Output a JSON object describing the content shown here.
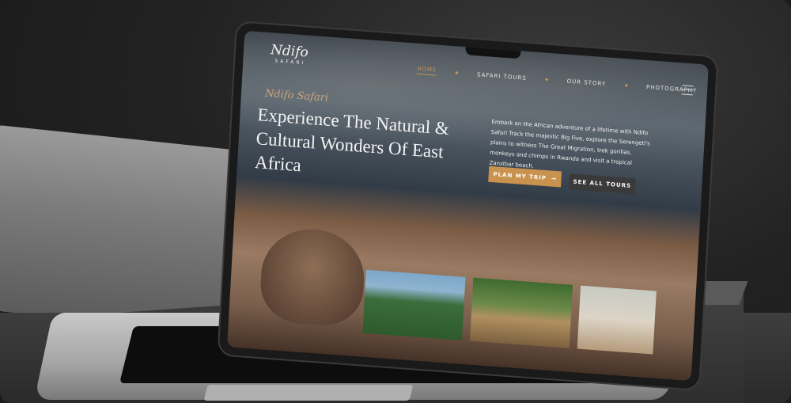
{
  "site": {
    "logo": {
      "name": "Ndifo",
      "sub": "SAFARI"
    },
    "nav": [
      {
        "label": "HOME",
        "active": true
      },
      {
        "label": "SAFARI TOURS",
        "active": false
      },
      {
        "label": "OUR STORY",
        "active": false
      },
      {
        "label": "PHOTOGRAPHY",
        "active": false
      }
    ],
    "hero": {
      "eyebrow": "Ndifo Safari",
      "headline": "Experience The Natural & Cultural Wonders Of East Africa",
      "intro": "Embark on the African adventure of a lifetime with Ndifo Safari Track the majestic Big Five, explore the Serengeti's plains to witness The Great Migration, trek gorillas, monkeys and chimps in Rwanda and visit a tropical Zanzibar beach.",
      "primary_button": "PLAN MY TRIP",
      "secondary_button": "SEE ALL TOURS"
    }
  },
  "colors": {
    "accent": "#c9924e",
    "button_dark": "#3a3a3a"
  }
}
